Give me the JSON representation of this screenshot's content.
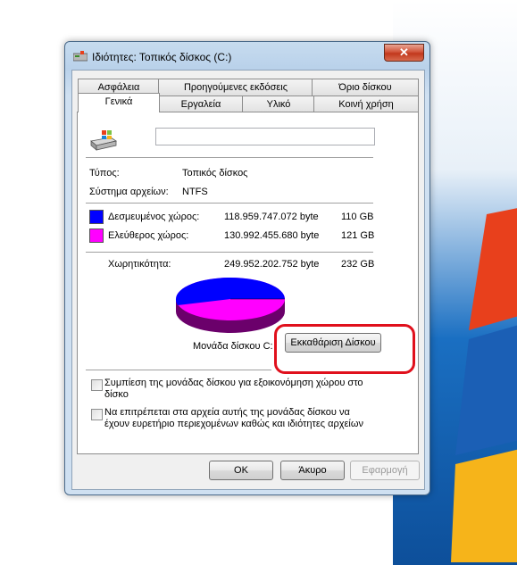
{
  "window": {
    "title": "Ιδιότητες: Τοπικός δίσκος (C:)",
    "close_label": "✕"
  },
  "tabs_back": [
    "Ασφάλεια",
    "Προηγούμενες εκδόσεις",
    "Όριο δίσκου"
  ],
  "tabs_front": [
    "Γενικά",
    "Εργαλεία",
    "Υλικό",
    "Κοινή χρήση"
  ],
  "general": {
    "name_value": "",
    "type_label": "Τύπος:",
    "type_value": "Τοπικός δίσκος",
    "fs_label": "Σύστημα αρχείων:",
    "fs_value": "NTFS",
    "used_label": "Δεσμευμένος χώρος:",
    "used_bytes": "118.959.747.072 byte",
    "used_gb": "110 GB",
    "free_label": "Ελεύθερος χώρος:",
    "free_bytes": "130.992.455.680 byte",
    "free_gb": "121 GB",
    "capacity_label": "Χωρητικότητα:",
    "capacity_bytes": "249.952.202.752 byte",
    "capacity_gb": "232 GB",
    "drive_label": "Μονάδα δίσκου C:",
    "cleanup_button": "Εκκαθάριση Δίσκου",
    "compress_label": "Συμπίεση της μονάδας δίσκου για εξοικονόμηση χώρου στο δίσκο",
    "index_label": "Να επιτρέπεται στα αρχεία αυτής της μονάδας δίσκου να έχουν ευρετήριο περιεχομένων καθώς και ιδιότητες αρχείων",
    "compress_checked": false,
    "index_checked": false,
    "used_fraction": 0.476,
    "used_color": "#0000ff",
    "free_color": "#ff00ff"
  },
  "buttons": {
    "ok": "OK",
    "cancel": "Άκυρο",
    "apply": "Εφαρμογή"
  }
}
